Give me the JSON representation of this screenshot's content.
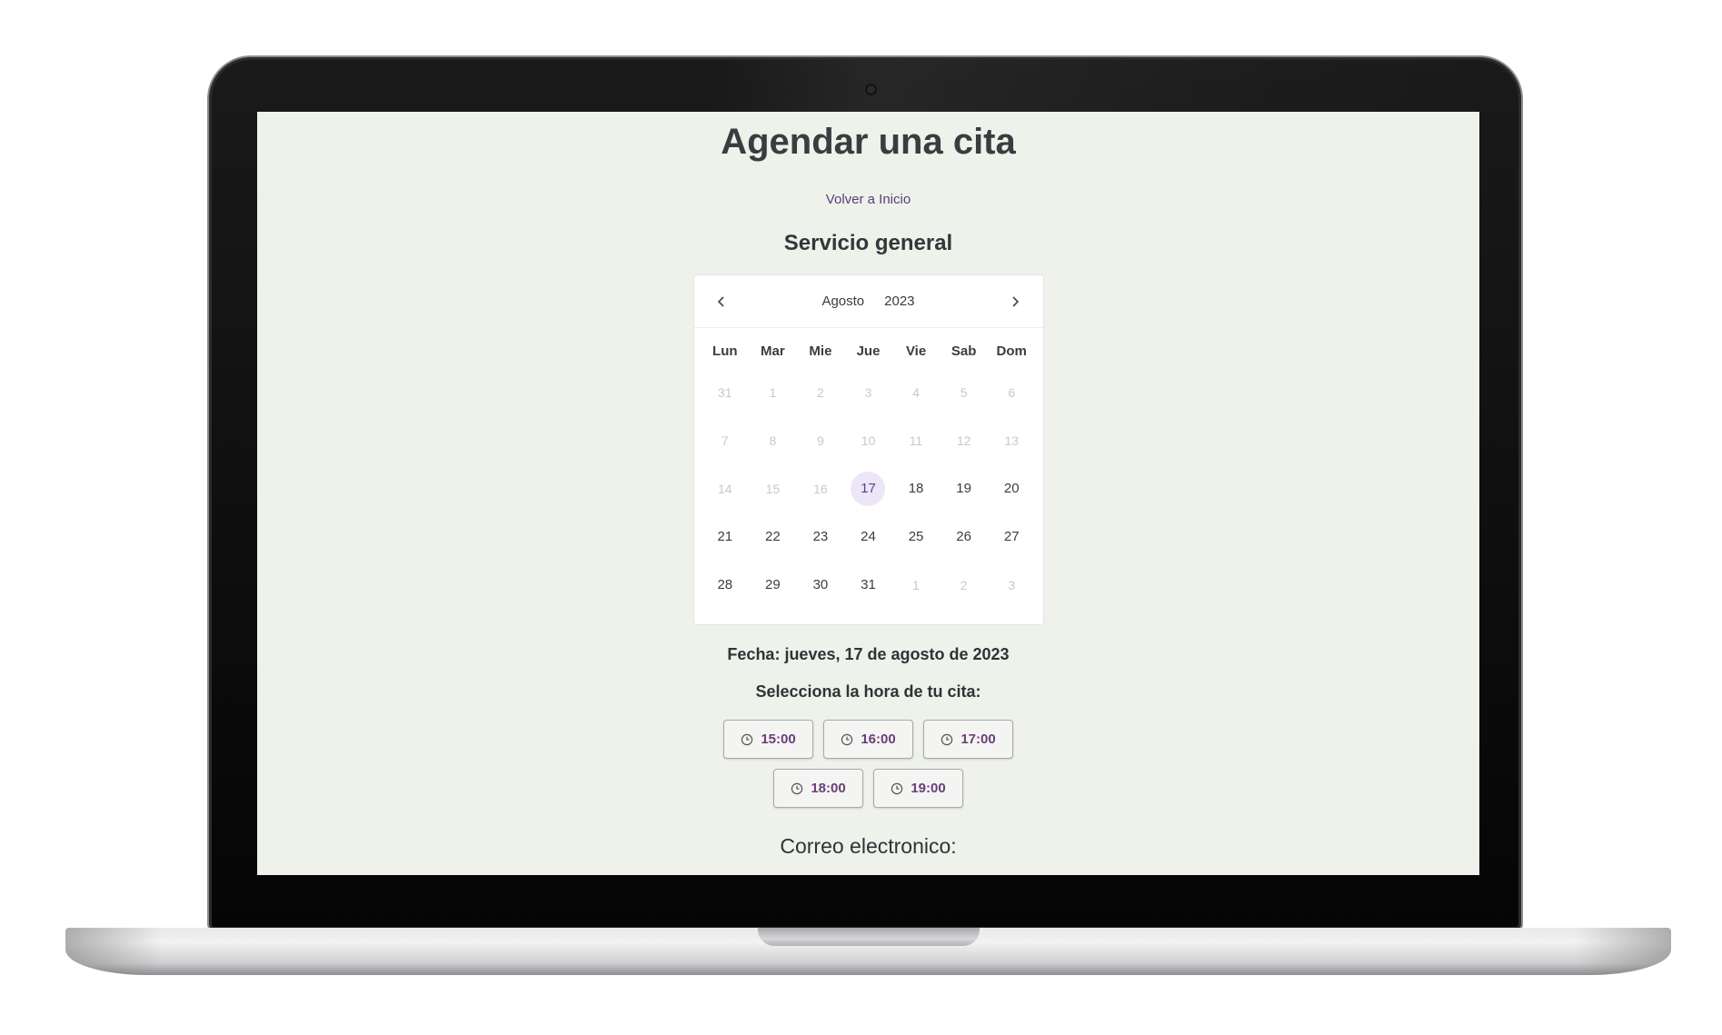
{
  "page": {
    "title": "Agendar una cita",
    "back_link": "Volver a Inicio",
    "service": "Servicio general"
  },
  "calendar": {
    "month": "Agosto",
    "year": "2023",
    "weekdays": [
      "Lun",
      "Mar",
      "Mie",
      "Jue",
      "Vie",
      "Sab",
      "Dom"
    ],
    "days": [
      {
        "label": "31",
        "state": "muted"
      },
      {
        "label": "1",
        "state": "muted"
      },
      {
        "label": "2",
        "state": "muted"
      },
      {
        "label": "3",
        "state": "muted"
      },
      {
        "label": "4",
        "state": "muted"
      },
      {
        "label": "5",
        "state": "muted"
      },
      {
        "label": "6",
        "state": "muted"
      },
      {
        "label": "7",
        "state": "muted"
      },
      {
        "label": "8",
        "state": "muted"
      },
      {
        "label": "9",
        "state": "muted"
      },
      {
        "label": "10",
        "state": "muted"
      },
      {
        "label": "11",
        "state": "muted"
      },
      {
        "label": "12",
        "state": "muted"
      },
      {
        "label": "13",
        "state": "muted"
      },
      {
        "label": "14",
        "state": "muted"
      },
      {
        "label": "15",
        "state": "muted"
      },
      {
        "label": "16",
        "state": "muted"
      },
      {
        "label": "17",
        "state": "selected"
      },
      {
        "label": "18",
        "state": "active"
      },
      {
        "label": "19",
        "state": "active"
      },
      {
        "label": "20",
        "state": "active"
      },
      {
        "label": "21",
        "state": "active"
      },
      {
        "label": "22",
        "state": "active"
      },
      {
        "label": "23",
        "state": "active"
      },
      {
        "label": "24",
        "state": "active"
      },
      {
        "label": "25",
        "state": "active"
      },
      {
        "label": "26",
        "state": "active"
      },
      {
        "label": "27",
        "state": "active"
      },
      {
        "label": "28",
        "state": "active"
      },
      {
        "label": "29",
        "state": "active"
      },
      {
        "label": "30",
        "state": "active"
      },
      {
        "label": "31",
        "state": "active"
      },
      {
        "label": "1",
        "state": "muted"
      },
      {
        "label": "2",
        "state": "muted"
      },
      {
        "label": "3",
        "state": "muted"
      }
    ]
  },
  "selection": {
    "fecha": "Fecha: jueves, 17 de agosto de 2023",
    "select_time_label": "Selecciona la hora de tu cita:",
    "time_slots": [
      "15:00",
      "16:00",
      "17:00",
      "18:00",
      "19:00"
    ],
    "slot_icon": "clock-icon"
  },
  "form": {
    "email_label": "Correo electronico:"
  },
  "colors": {
    "background": "#eef2eb",
    "accent": "#6a3e7a",
    "selected_day_bg": "#ece6f7"
  }
}
